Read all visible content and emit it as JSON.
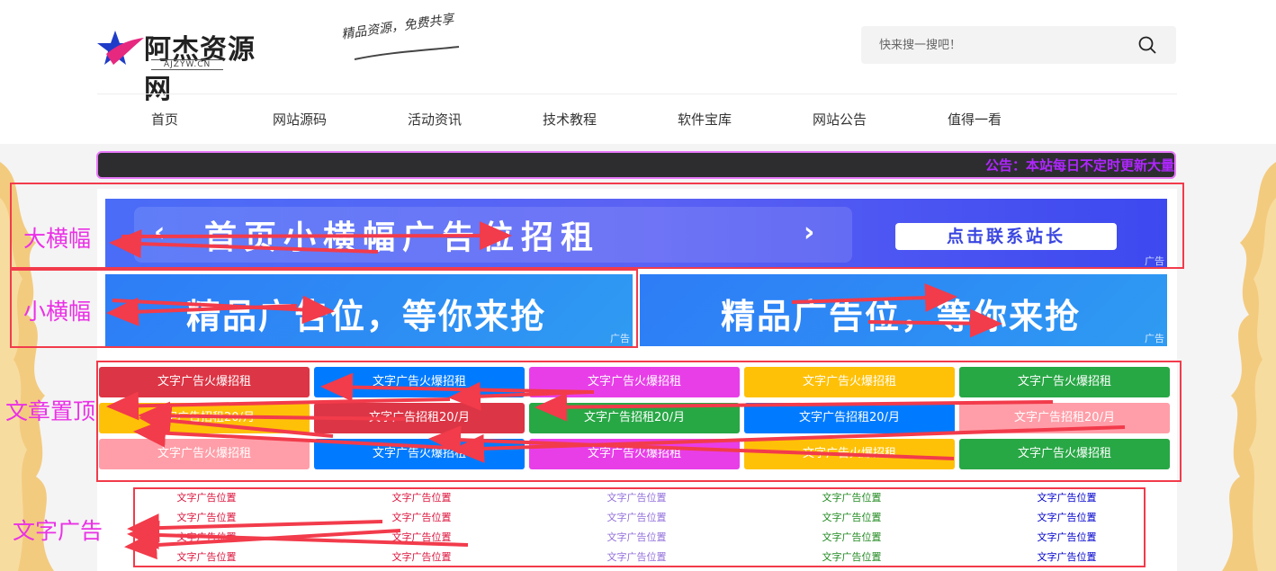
{
  "header": {
    "logo_text": "阿杰资源网",
    "logo_sub": "AJZYW.CN",
    "slogan": "精品资源，免费共享",
    "search_placeholder": "快来搜一搜吧！"
  },
  "nav": {
    "items": [
      {
        "label": "首页"
      },
      {
        "label": "网站源码"
      },
      {
        "label": "活动资讯"
      },
      {
        "label": "技术教程"
      },
      {
        "label": "软件宝库"
      },
      {
        "label": "网站公告"
      },
      {
        "label": "值得一看"
      }
    ]
  },
  "notice": {
    "text": "公告：本站每日不定时更新大量"
  },
  "big_banner": {
    "arrow_left": "‹",
    "arrow_right": "›",
    "text": "首页小横幅广告位招租",
    "button": "点击联系站长",
    "ad_tag": "广告"
  },
  "small_banners": [
    {
      "text": "精品广告位，等你来抢",
      "ad_tag": "广告"
    },
    {
      "text": "精品广告位，等你来抢",
      "ad_tag": "广告"
    }
  ],
  "top_buttons": [
    {
      "label": "文字广告火爆招租",
      "color": "#dc3545"
    },
    {
      "label": "文字广告火爆招租",
      "color": "#007bff"
    },
    {
      "label": "文字广告火爆招租",
      "color": "#e83ee8"
    },
    {
      "label": "文字广告火爆招租",
      "color": "#ffc107"
    },
    {
      "label": "文字广告火爆招租",
      "color": "#28a745"
    },
    {
      "label": "文字广告招租20/月",
      "color": "#ffc107"
    },
    {
      "label": "文字广告招租20/月",
      "color": "#dc3545"
    },
    {
      "label": "文字广告招租20/月",
      "color": "#28a745"
    },
    {
      "label": "文字广告招租20/月",
      "color": "#007bff"
    },
    {
      "label": "文字广告招租20/月",
      "color": "#ff9ea8"
    },
    {
      "label": "文字广告火爆招租",
      "color": "#ff9ea8"
    },
    {
      "label": "文字广告火爆招租",
      "color": "#007bff"
    },
    {
      "label": "文字广告火爆招租",
      "color": "#e83ee8"
    },
    {
      "label": "文字广告火爆招租",
      "color": "#ffc107"
    },
    {
      "label": "文字广告火爆招租",
      "color": "#28a745"
    }
  ],
  "text_ads": [
    {
      "label": "文字广告位置",
      "color": "#dc143c"
    },
    {
      "label": "文字广告位置",
      "color": "#dc143c"
    },
    {
      "label": "文字广告位置",
      "color": "#9370db"
    },
    {
      "label": "文字广告位置",
      "color": "#228b22"
    },
    {
      "label": "文字广告位置",
      "color": "#0000cd"
    },
    {
      "label": "文字广告位置",
      "color": "#dc143c"
    },
    {
      "label": "文字广告位置",
      "color": "#dc143c"
    },
    {
      "label": "文字广告位置",
      "color": "#9370db"
    },
    {
      "label": "文字广告位置",
      "color": "#228b22"
    },
    {
      "label": "文字广告位置",
      "color": "#0000cd"
    },
    {
      "label": "文字广告位置",
      "color": "#dc143c"
    },
    {
      "label": "文字广告位置",
      "color": "#dc143c"
    },
    {
      "label": "文字广告位置",
      "color": "#9370db"
    },
    {
      "label": "文字广告位置",
      "color": "#228b22"
    },
    {
      "label": "文字广告位置",
      "color": "#0000cd"
    },
    {
      "label": "文字广告位置",
      "color": "#dc143c"
    },
    {
      "label": "文字广告位置",
      "color": "#dc143c"
    },
    {
      "label": "文字广告位置",
      "color": "#9370db"
    },
    {
      "label": "文字广告位置",
      "color": "#228b22"
    },
    {
      "label": "文字广告位置",
      "color": "#0000cd"
    }
  ],
  "annotations": {
    "big_banner": "大横幅",
    "small_banner": "小横幅",
    "top_articles": "文章置顶",
    "text_ads": "文字广告",
    "box_color": "#f23b4b",
    "label_color": "#ea31e6"
  }
}
